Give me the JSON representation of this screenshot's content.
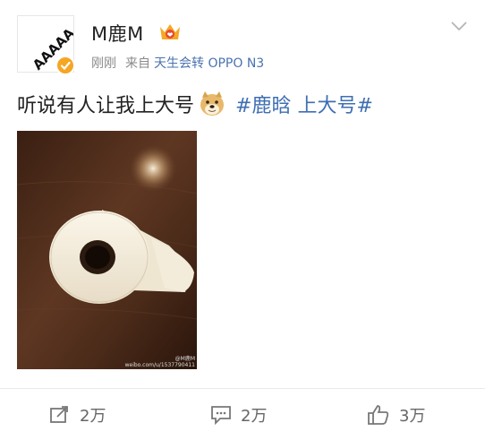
{
  "post": {
    "author": {
      "name": "M鹿M",
      "avatar_text": "AAAAA",
      "verified": true
    },
    "time": "刚刚",
    "source_prefix": "来自",
    "source_device": "天生会转 OPPO N3",
    "text": "听说有人让我上大号",
    "emoji": "doge-emoji",
    "hashtag": "#鹿晗 上大号#",
    "image": {
      "subject": "toilet-paper-roll",
      "watermark_line1": "@M鹿M",
      "watermark_line2": "weibo.com/u/1537790411"
    }
  },
  "actions": {
    "repost_count": "2万",
    "comment_count": "2万",
    "like_count": "3万"
  },
  "colors": {
    "hashtag": "#3e6fb2",
    "verified_badge": "#f5a623",
    "text": "#222222",
    "meta": "#8a8a8a"
  }
}
